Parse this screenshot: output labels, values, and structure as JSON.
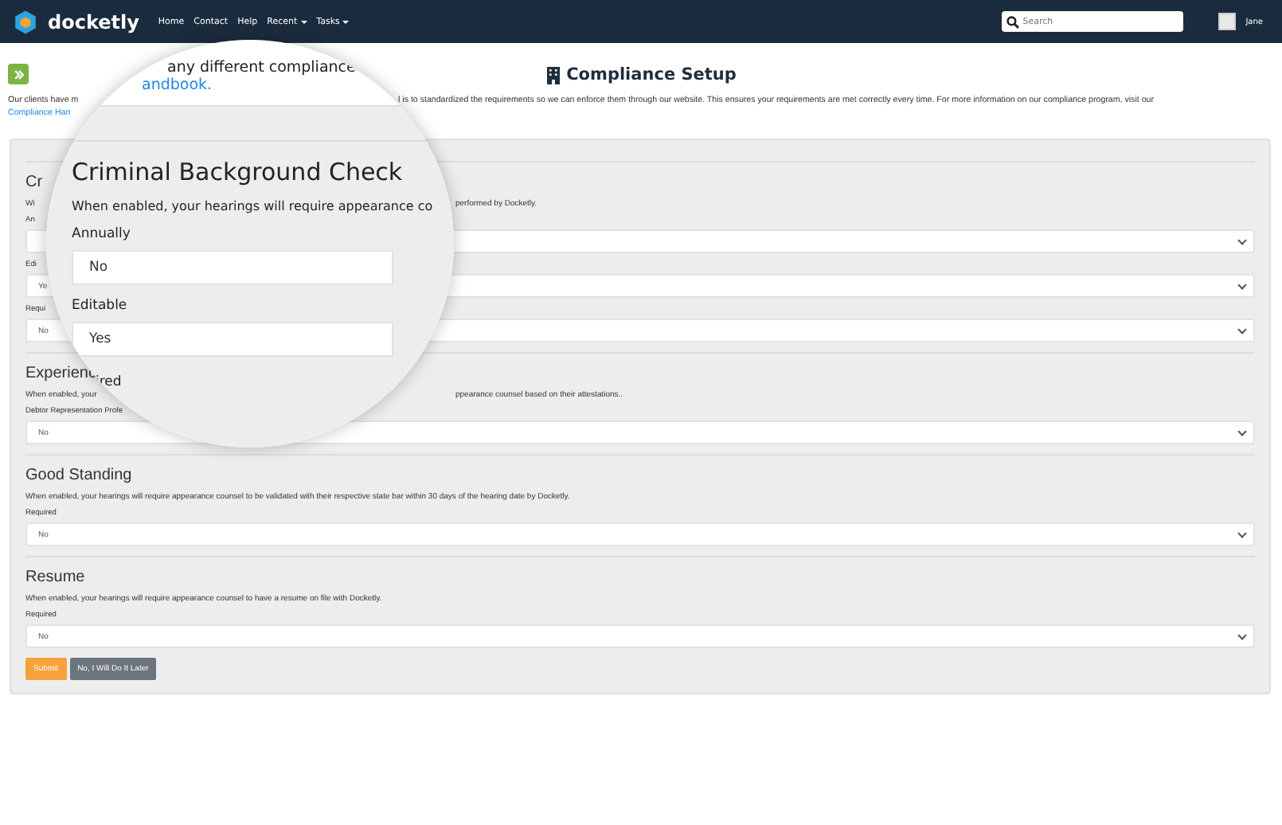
{
  "navbar": {
    "brand": "docketly",
    "links": [
      {
        "label": "Home",
        "dropdown": false
      },
      {
        "label": "Contact",
        "dropdown": false
      },
      {
        "label": "Help",
        "dropdown": false
      },
      {
        "label": "Recent",
        "dropdown": true
      },
      {
        "label": "Tasks",
        "dropdown": true
      }
    ],
    "search": {
      "placeholder": "Search"
    },
    "user": "Jane"
  },
  "page": {
    "title": "Compliance Setup",
    "intro_left": "Our clients have m",
    "intro_right": "l is to standardized the requirements so we can enforce them through our website. This ensures your requirements are met correctly every time. For more information on our compliance program, visit our",
    "intro_link": "Compliance Han"
  },
  "sections": [
    {
      "title": "Cr",
      "description_left": "Wi",
      "description_right": "performed by Docketly.",
      "fields": [
        {
          "label": "An"
        },
        {
          "label": "Edi",
          "value": "Ye"
        },
        {
          "label": "Requi",
          "value": "No"
        }
      ]
    },
    {
      "title": "Experienc",
      "description_left": "When enabled, your",
      "description_right": "ppearance counsel based on their attestations..",
      "fields": [
        {
          "label": "Debtor Representation Profe",
          "value": "No"
        }
      ]
    },
    {
      "title": "Good Standing",
      "description_left": "When enabled, your hearings will require appearance counsel to be validated with their respective state bar within 30 days of the hearing date by Docketly.",
      "fields": [
        {
          "label": "Required",
          "value": "No"
        }
      ]
    },
    {
      "title": "Resume",
      "description_left": "When enabled, your hearings will require appearance counsel to have a resume on file with Docketly.",
      "fields": [
        {
          "label": "Required",
          "value": "No"
        }
      ]
    }
  ],
  "buttons": [
    {
      "label": "Submit",
      "kind": "primary"
    },
    {
      "label": "No, I Will Do It Later",
      "kind": "secondary"
    }
  ],
  "magnifier": {
    "intro": "any different compliance",
    "link": "andbook.",
    "title": "Criminal Background Check",
    "description": "When enabled, your hearings will require appearance co",
    "fields": [
      {
        "label": "Annually",
        "value": "No"
      },
      {
        "label": "Editable",
        "value": "Yes"
      },
      {
        "label": "ired"
      }
    ]
  }
}
